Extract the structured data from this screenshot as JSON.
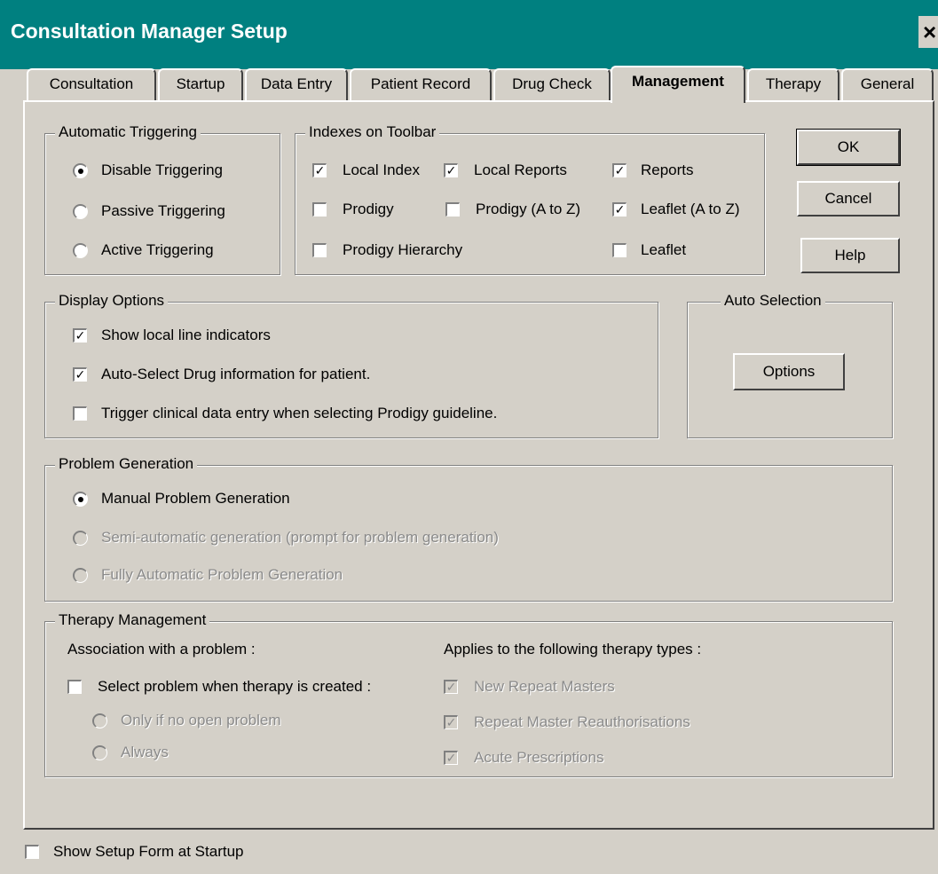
{
  "window": {
    "title": "Consultation Manager Setup",
    "close_glyph": "×"
  },
  "tabs": [
    {
      "label": "Consultation"
    },
    {
      "label": "Startup"
    },
    {
      "label": "Data Entry"
    },
    {
      "label": "Patient Record"
    },
    {
      "label": "Drug Check"
    },
    {
      "label": "Management",
      "active": true
    },
    {
      "label": "Therapy"
    },
    {
      "label": "General"
    }
  ],
  "automatic_triggering": {
    "legend": "Automatic Triggering",
    "options": [
      {
        "label": "Disable Triggering",
        "selected": true
      },
      {
        "label": "Passive Triggering",
        "selected": false
      },
      {
        "label": "Active Triggering",
        "selected": false
      }
    ]
  },
  "indexes_on_toolbar": {
    "legend": "Indexes on Toolbar",
    "items": [
      {
        "label": "Local Index",
        "checked": true
      },
      {
        "label": "Local Reports",
        "checked": true
      },
      {
        "label": "Reports",
        "checked": true
      },
      {
        "label": "Prodigy",
        "checked": false
      },
      {
        "label": "Prodigy (A to Z)",
        "checked": false
      },
      {
        "label": "Leaflet (A to Z)",
        "checked": true
      },
      {
        "label": "Prodigy Hierarchy",
        "checked": false
      },
      {
        "label": "Leaflet",
        "checked": false
      }
    ]
  },
  "buttons": {
    "ok": "OK",
    "cancel": "Cancel",
    "help": "Help",
    "options": "Options"
  },
  "display_options": {
    "legend": "Display Options",
    "items": [
      {
        "label": "Show local line indicators",
        "checked": true
      },
      {
        "label": "Auto-Select Drug information for patient.",
        "checked": true
      },
      {
        "label": "Trigger clinical data entry when selecting Prodigy guideline.",
        "checked": false
      }
    ]
  },
  "auto_selection": {
    "legend": "Auto Selection"
  },
  "problem_generation": {
    "legend": "Problem Generation",
    "options": [
      {
        "label": "Manual Problem Generation",
        "selected": true,
        "enabled": true
      },
      {
        "label": "Semi-automatic generation (prompt for problem generation)",
        "selected": false,
        "enabled": false
      },
      {
        "label": "Fully Automatic Problem Generation",
        "selected": false,
        "enabled": false
      }
    ]
  },
  "therapy_management": {
    "legend": "Therapy Management",
    "association_heading": "Association with a problem :",
    "select_problem": {
      "label": "Select problem when therapy is created :",
      "checked": false
    },
    "sub_options": [
      {
        "label": "Only if no open problem",
        "enabled": false
      },
      {
        "label": "Always",
        "enabled": false
      }
    ],
    "applies_heading": "Applies to the following therapy types :",
    "therapy_types": [
      {
        "label": "New Repeat Masters",
        "checked": true,
        "enabled": false
      },
      {
        "label": "Repeat Master Reauthorisations",
        "checked": true,
        "enabled": false
      },
      {
        "label": "Acute Prescriptions",
        "checked": true,
        "enabled": false
      }
    ]
  },
  "footer": {
    "show_setup_label": "Show Setup Form at Startup",
    "checked": false
  },
  "glyphs": {
    "check": "✓"
  }
}
